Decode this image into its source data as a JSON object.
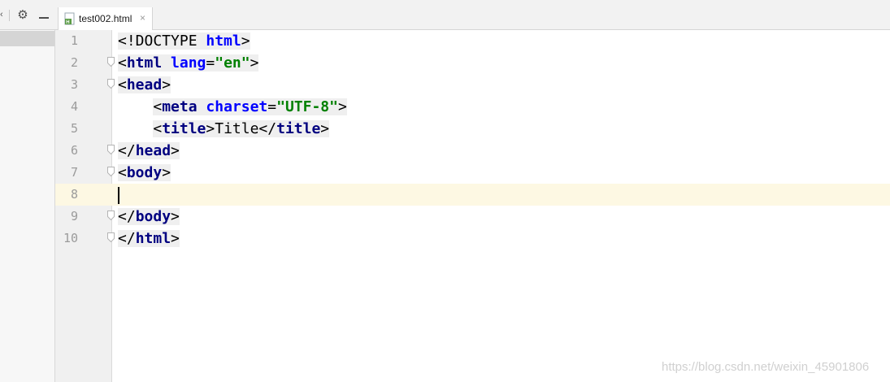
{
  "toolbar": {
    "icons": [
      "chevron-icon",
      "gear-icon",
      "minimize-icon"
    ]
  },
  "tab": {
    "label": "test002.html",
    "close": "×",
    "icon": "html-file-icon"
  },
  "editor": {
    "current_line": 8,
    "lines": [
      {
        "number": "1",
        "indent": "",
        "tokens": [
          {
            "t": "<!DOCTYPE ",
            "c": "plain"
          },
          {
            "t": "html",
            "c": "attr"
          },
          {
            "t": ">",
            "c": "plain"
          }
        ]
      },
      {
        "number": "2",
        "indent": "",
        "tokens": [
          {
            "t": "<",
            "c": "plain"
          },
          {
            "t": "html",
            "c": "tag"
          },
          {
            "t": " ",
            "c": "plain"
          },
          {
            "t": "lang",
            "c": "attr"
          },
          {
            "t": "=",
            "c": "plain"
          },
          {
            "t": "\"en\"",
            "c": "val"
          },
          {
            "t": ">",
            "c": "plain"
          }
        ]
      },
      {
        "number": "3",
        "indent": "",
        "tokens": [
          {
            "t": "<",
            "c": "plain"
          },
          {
            "t": "head",
            "c": "tag"
          },
          {
            "t": ">",
            "c": "plain"
          }
        ]
      },
      {
        "number": "4",
        "indent": "    ",
        "tokens": [
          {
            "t": "<",
            "c": "plain"
          },
          {
            "t": "meta",
            "c": "tag"
          },
          {
            "t": " ",
            "c": "plain"
          },
          {
            "t": "charset",
            "c": "attr"
          },
          {
            "t": "=",
            "c": "plain"
          },
          {
            "t": "\"UTF-8\"",
            "c": "val"
          },
          {
            "t": ">",
            "c": "plain"
          }
        ]
      },
      {
        "number": "5",
        "indent": "    ",
        "tokens": [
          {
            "t": "<",
            "c": "plain"
          },
          {
            "t": "title",
            "c": "tag"
          },
          {
            "t": ">",
            "c": "plain"
          },
          {
            "t": "Title",
            "c": "text"
          },
          {
            "t": "</",
            "c": "plain"
          },
          {
            "t": "title",
            "c": "tag"
          },
          {
            "t": ">",
            "c": "plain"
          }
        ]
      },
      {
        "number": "6",
        "indent": "",
        "tokens": [
          {
            "t": "</",
            "c": "plain"
          },
          {
            "t": "head",
            "c": "tag"
          },
          {
            "t": ">",
            "c": "plain"
          }
        ]
      },
      {
        "number": "7",
        "indent": "",
        "tokens": [
          {
            "t": "<",
            "c": "plain"
          },
          {
            "t": "body",
            "c": "tag"
          },
          {
            "t": ">",
            "c": "plain"
          }
        ]
      },
      {
        "number": "8",
        "indent": "",
        "tokens": []
      },
      {
        "number": "9",
        "indent": "",
        "tokens": [
          {
            "t": "</",
            "c": "plain"
          },
          {
            "t": "body",
            "c": "tag"
          },
          {
            "t": ">",
            "c": "plain"
          }
        ]
      },
      {
        "number": "10",
        "indent": "",
        "tokens": [
          {
            "t": "</",
            "c": "plain"
          },
          {
            "t": "html",
            "c": "tag"
          },
          {
            "t": ">",
            "c": "plain"
          }
        ]
      }
    ],
    "fold_markers": [
      "2",
      "3",
      "6",
      "7",
      "9",
      "10"
    ]
  },
  "watermark": "https://blog.csdn.net/weixin_45901806",
  "colors": {
    "tag": "#000080",
    "attribute": "#0000ff",
    "value": "#008000",
    "current_line": "#fdf8e3",
    "gutter": "#f0f0f0"
  }
}
